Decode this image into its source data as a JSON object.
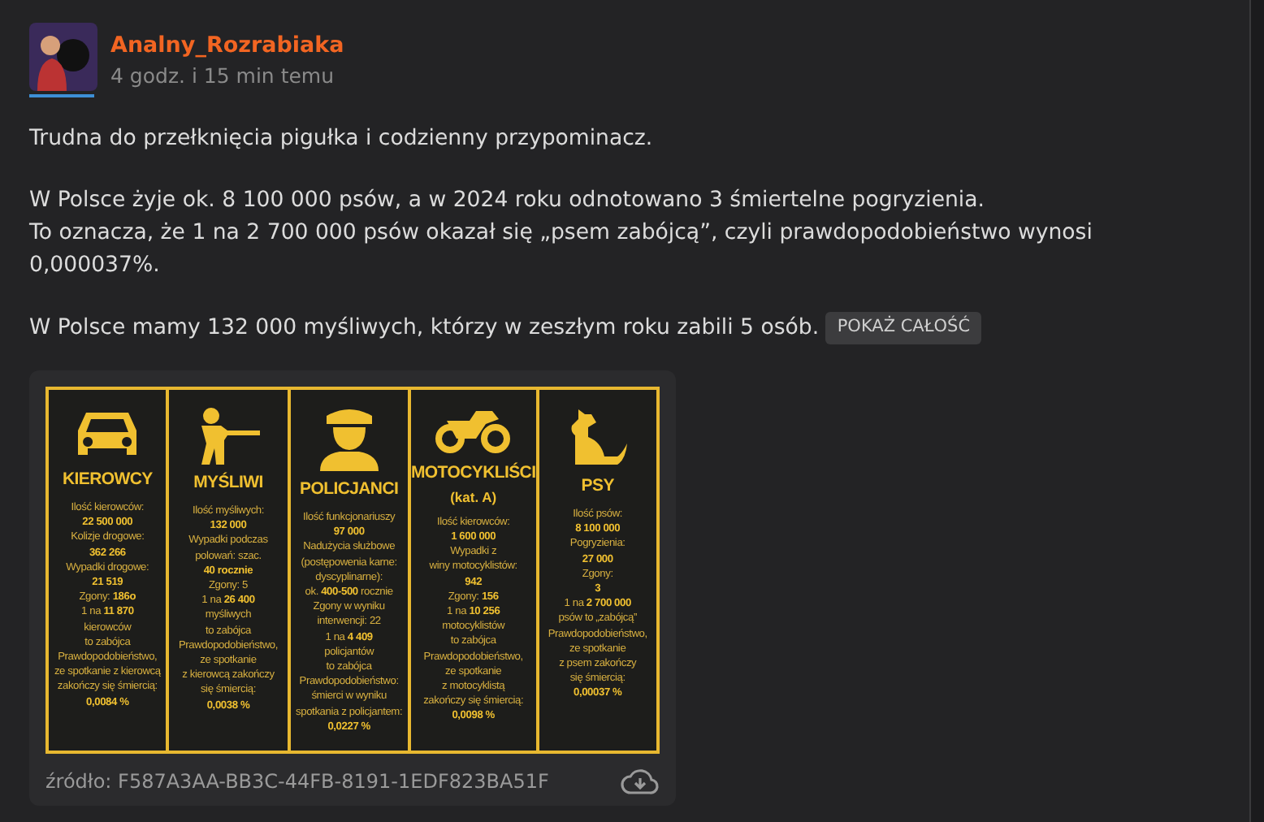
{
  "post": {
    "author": "Analny_Rozrabiaka",
    "time": "4 godz. i 15 min temu",
    "paragraphs": [
      [
        "Trudna do przełknięcia pigułka i codzienny przypominacz."
      ],
      [
        "W Polsce żyje ok. 8 100 000 psów, a w 2024 roku odnotowano 3 śmiertelne pogryzienia.",
        "To oznacza, że 1 na 2 700 000 psów okazał się „psem zabójcą”, czyli prawdopodobieństwo wynosi 0,000037%."
      ],
      [
        "W Polsce mamy 132 000 myśliwych, którzy w zeszłym roku zabili 5 osób."
      ]
    ],
    "show_more": "POKAŻ CAŁOŚĆ"
  },
  "attachment": {
    "infographic": {
      "columns": [
        {
          "title": "KIEROWCY",
          "lines": [
            "Ilość kierowców:",
            "**22 500 000**",
            "Kolizje drogowe:",
            "**362 266**",
            "Wypadki drogowe:",
            "**21 519**",
            "Zgony: **186o**",
            "1 na **11 870**",
            "kierowców",
            "to zabójca",
            "Prawdopodobieństwo,",
            "ze spotkanie z kierowcą",
            "zakończy się śmiercią:",
            "**0,0084 %**"
          ]
        },
        {
          "title": "MYŚLIWI",
          "lines": [
            "Ilość myśliwych:",
            "**132 000**",
            "Wypadki podczas",
            "polowań: szac.",
            "**40 rocznie**",
            "Zgony: 5",
            "1 na **26 400**",
            "myśliwych",
            "to zabójca",
            "Prawdopodobieństwo,",
            "ze spotkanie",
            "z kierowcą zakończy",
            "się śmiercią:",
            "**0,0038 %**"
          ]
        },
        {
          "title": "POLICJANCI",
          "lines": [
            "Ilość funkcjonariuszy",
            "**97 000**",
            "Nadużycia służbowe",
            "(postępowenia karne:",
            "dyscyplinarne):",
            "ok. **400-500** rocznie",
            "Zgony w wyniku",
            "interwencji: 22",
            "1 na **4 409**",
            "policjantów",
            "to zabójca",
            "Prawdopodobieństwo:",
            "śmierci w wyniku",
            "spotkania z policjantem:",
            "**0,0227 %**"
          ]
        },
        {
          "title": "MOTOCYKLIŚCI",
          "subtitle": "(kat. A)",
          "lines": [
            "Ilość kierowców:",
            "**1 600 000**",
            "Wypadki z",
            "winy motocyklistów:",
            "**942**",
            "Zgony: **156**",
            "1 na **10 256**",
            "motocyklistów",
            "to zabójca",
            "Prawdopodobieństwo,",
            "ze spotkanie",
            "z motocyklistą",
            "zakończy się śmiercią:",
            "**0,0098 %**"
          ]
        },
        {
          "title": "PSY",
          "lines": [
            "Ilość psów:",
            "**8 100 000**",
            "Pogryzienia:",
            "**27 000**",
            "Zgony:",
            "**3**",
            "1 na **2 700 000**",
            "psów to „zabójcą”",
            "Prawdopodobieństwo,",
            "ze spotkanie",
            "z psem zakończy",
            "się śmiercią:",
            "**0,00037 %**"
          ]
        }
      ]
    },
    "source": "źródło: F587A3AA-BB3C-44FB-8191-1EDF823BA51F"
  }
}
